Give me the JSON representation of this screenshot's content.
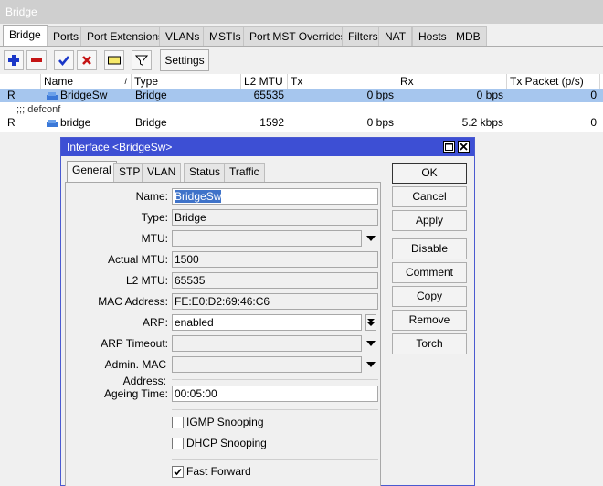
{
  "window": {
    "title": "Bridge"
  },
  "tabs": [
    "Bridge",
    "Ports",
    "Port Extensions",
    "VLANs",
    "MSTIs",
    "Port MST Overrides",
    "Filters",
    "NAT",
    "Hosts",
    "MDB"
  ],
  "toolbar": {
    "add_icon": "plus-icon",
    "remove_icon": "minus-icon",
    "enable_icon": "checkmark-icon",
    "disable_icon": "x-icon",
    "comment_icon": "note-icon",
    "filter_icon": "funnel-icon",
    "settings_label": "Settings"
  },
  "grid": {
    "columns": [
      "Name",
      "Type",
      "L2 MTU",
      "Tx",
      "Rx",
      "Tx Packet (p/s)"
    ],
    "rows": [
      {
        "flag": "R",
        "name": "BridgeSw",
        "type": "Bridge",
        "l2mtu": "65535",
        "tx": "0 bps",
        "rx": "0 bps",
        "txp": "0"
      },
      {
        "flag": "R",
        "name": "bridge",
        "type": "Bridge",
        "l2mtu": "1592",
        "tx": "0 bps",
        "rx": "5.2 kbps",
        "txp": "0"
      }
    ],
    "comment": ";;; defconf"
  },
  "dialog": {
    "title": "Interface <BridgeSw>",
    "tabs": [
      "General",
      "STP",
      "VLAN",
      "Status",
      "Traffic"
    ],
    "fields": {
      "name_label": "Name:",
      "name_value": "BridgeSw",
      "type_label": "Type:",
      "type_value": "Bridge",
      "mtu_label": "MTU:",
      "mtu_value": "",
      "actual_mtu_label": "Actual MTU:",
      "actual_mtu_value": "1500",
      "l2mtu_label": "L2 MTU:",
      "l2mtu_value": "65535",
      "mac_label": "MAC Address:",
      "mac_value": "FE:E0:D2:69:46:C6",
      "arp_label": "ARP:",
      "arp_value": "enabled",
      "arp_timeout_label": "ARP Timeout:",
      "arp_timeout_value": "",
      "admin_mac_label": "Admin. MAC Address:",
      "admin_mac_value": "",
      "ageing_label": "Ageing Time:",
      "ageing_value": "00:05:00"
    },
    "checks": {
      "igmp_label": "IGMP Snooping",
      "igmp": false,
      "dhcp_label": "DHCP Snooping",
      "dhcp": false,
      "ff_label": "Fast Forward",
      "ff": true
    },
    "buttons": [
      "OK",
      "Cancel",
      "Apply",
      "Disable",
      "Comment",
      "Copy",
      "Remove",
      "Torch"
    ]
  }
}
